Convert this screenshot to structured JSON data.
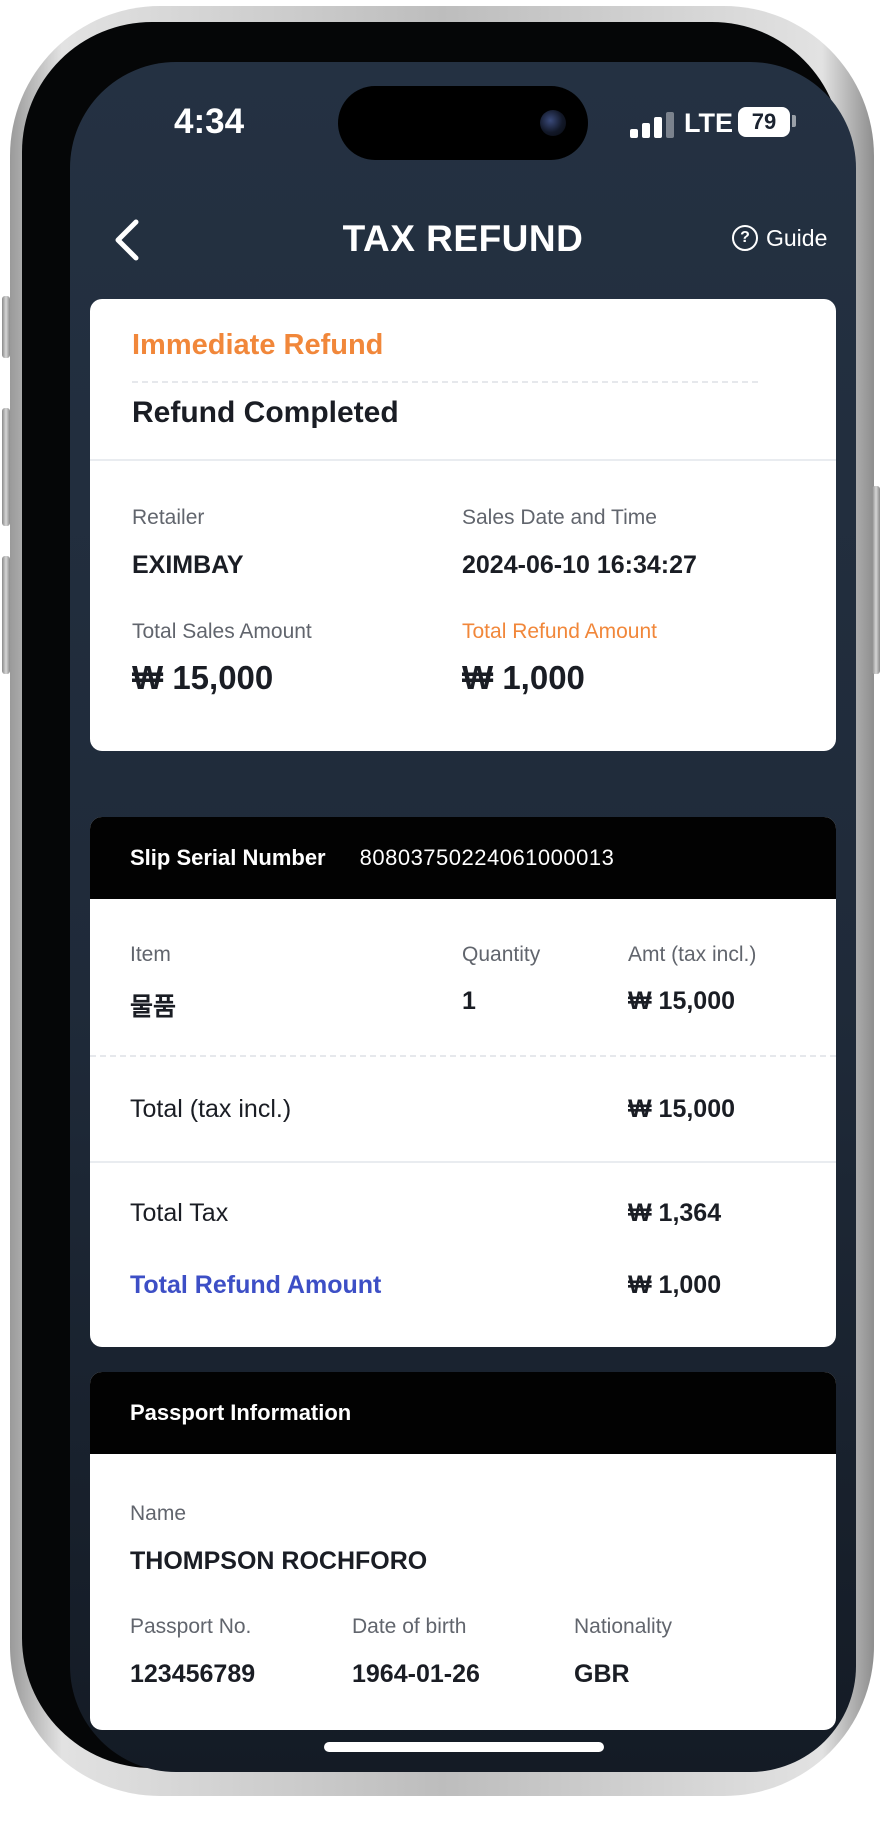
{
  "status_bar": {
    "time": "4:34",
    "network": "LTE",
    "battery": "79"
  },
  "nav": {
    "title": "TAX REFUND",
    "guide_label": "Guide",
    "guide_icon": "?"
  },
  "summary": {
    "refund_type": "Immediate Refund",
    "status": "Refund Completed",
    "retailer_label": "Retailer",
    "retailer_value": "EXIMBAY",
    "sales_date_label": "Sales Date and Time",
    "sales_date_value": "2024-06-10 16:34:27",
    "total_sales_label": "Total Sales Amount",
    "total_sales_value": "₩ 15,000",
    "total_refund_label": "Total Refund Amount",
    "total_refund_value": "₩ 1,000"
  },
  "slip": {
    "serial_label": "Slip Serial Number",
    "serial_value": "80803750224061000013",
    "item_header": "Item",
    "quantity_header": "Quantity",
    "amount_header": "Amt (tax incl.)",
    "items": [
      {
        "name": "물품",
        "quantity": "1",
        "amount": "₩ 15,000"
      }
    ],
    "total_incl_label": "Total (tax incl.)",
    "total_incl_value": "₩ 15,000",
    "total_tax_label": "Total Tax",
    "total_tax_value": "₩ 1,364",
    "total_refund_label": "Total Refund Amount",
    "total_refund_value": "₩ 1,000"
  },
  "passport": {
    "header": "Passport Information",
    "name_label": "Name",
    "name_value": "THOMPSON ROCHFORO",
    "passport_no_label": "Passport No.",
    "passport_no_value": "123456789",
    "dob_label": "Date of birth",
    "dob_value": "1964-01-26",
    "nationality_label": "Nationality",
    "nationality_value": "GBR"
  },
  "colors": {
    "accent_orange": "#f1873a",
    "accent_blue": "#3d4fc6",
    "background": "#243142"
  }
}
